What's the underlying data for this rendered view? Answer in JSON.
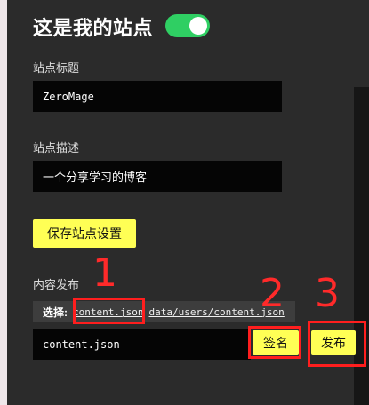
{
  "site": {
    "title": "这是我的站点",
    "toggle_on": true
  },
  "fields": {
    "title_label": "站点标题",
    "title_value": "ZeroMage",
    "desc_label": "站点描述",
    "desc_value": "一个分享学习的博客"
  },
  "save_button": "保存站点设置",
  "publish": {
    "section_label": "内容发布",
    "select_label": "选择:",
    "options": [
      "content.json",
      "data/users/content.json"
    ],
    "file_value": "content.json",
    "sign_button": "签名",
    "publish_button": "发布"
  },
  "annotations": [
    "1",
    "2",
    "3"
  ],
  "colors": {
    "background": "#2b2b2b",
    "toggle": "#2fcf63",
    "button": "#ffff55",
    "highlight": "#ff1e1e"
  }
}
